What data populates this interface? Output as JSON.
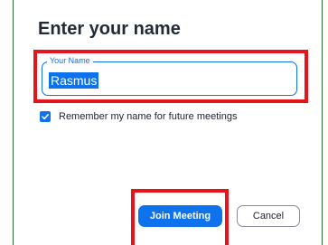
{
  "dialog": {
    "title": "Enter your name",
    "name_field": {
      "legend": "Your Name",
      "value": "Rasmus"
    },
    "remember": {
      "label": "Remember my name for future meetings",
      "checked": true
    },
    "join_label": "Join Meeting",
    "cancel_label": "Cancel"
  },
  "colors": {
    "accent": "#0e72ed",
    "highlight": "#e8141c",
    "frame_border": "#2f6b2f",
    "title_text": "#222b35"
  }
}
